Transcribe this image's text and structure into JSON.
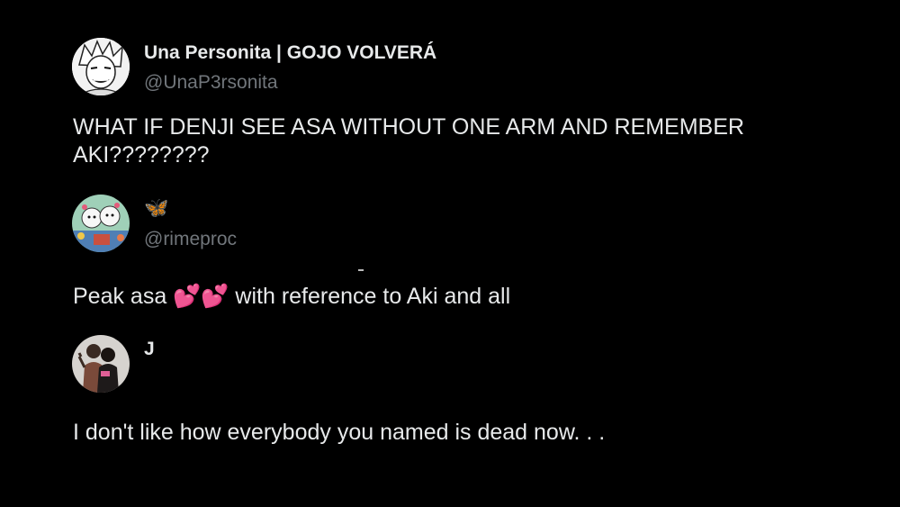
{
  "posts": [
    {
      "display_name": "Una Personita | GOJO VOLVERÁ",
      "handle": "@UnaP3rsonita",
      "text": "WHAT IF DENJI SEE ASA WITHOUT ONE ARM AND REMEMBER AKI????????",
      "avatar_icon": "manga-character-avatar-icon"
    },
    {
      "display_name": "🦋",
      "handle": "@rimeproc",
      "text_before": "Peak asa",
      "emoji": "💕💕",
      "text_after": "with reference to Aki and all",
      "avatar_icon": "cartoon-characters-avatar-icon",
      "name_color": "#5aa7ff"
    },
    {
      "display_name": "J",
      "handle": "",
      "text": "I don't like how everybody you named is dead now. . .",
      "avatar_icon": "two-people-photo-avatar-icon"
    }
  ],
  "colors": {
    "background": "#000000",
    "text": "#e7e9ea",
    "handle": "#71767b",
    "heart": "#e8325a"
  }
}
